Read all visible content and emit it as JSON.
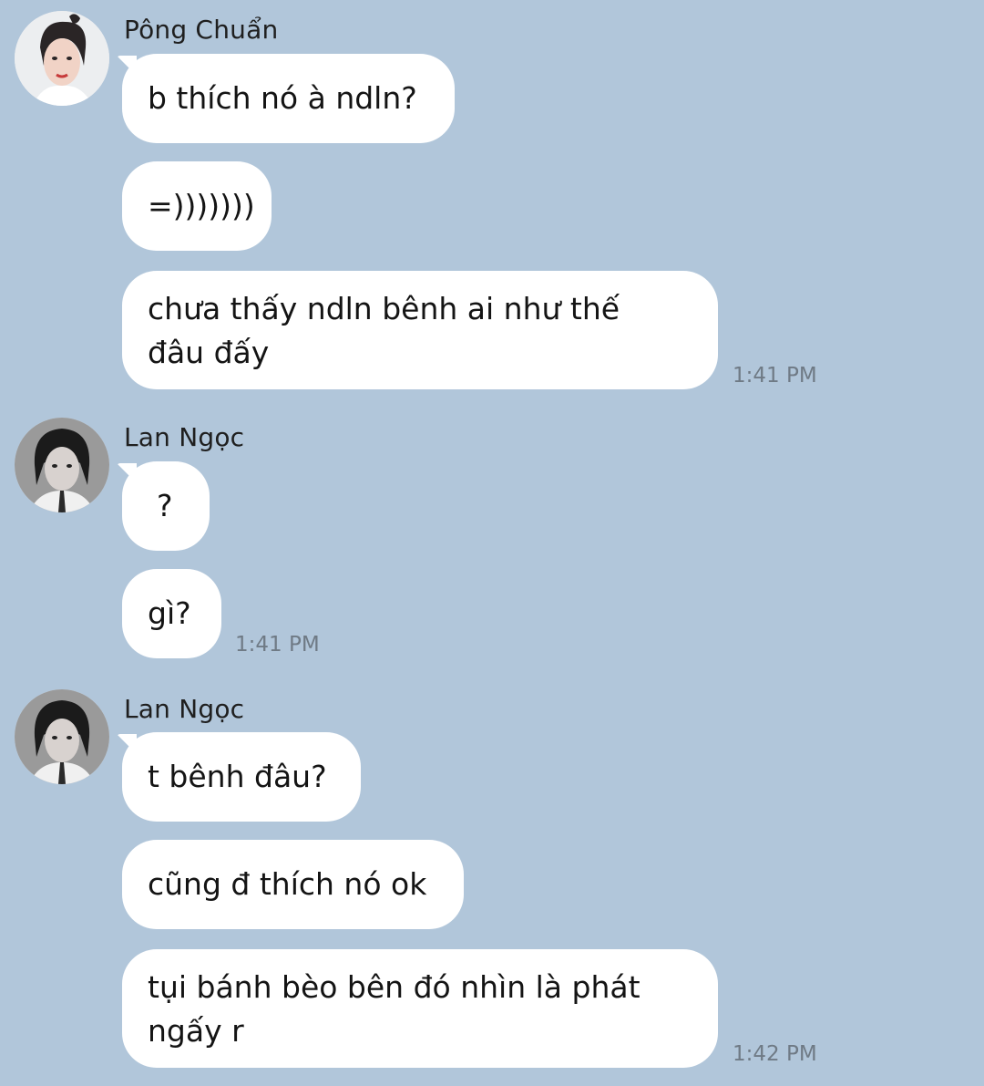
{
  "groups": [
    {
      "sender": "Pông Chuẩn",
      "avatar_icon": "contact-avatar-pong-chuan",
      "messages": [
        "b thích nó à ndln?",
        "=)))))))",
        "chưa thấy ndln bênh ai như thế\nđâu đấy"
      ],
      "time": "1:41 PM"
    },
    {
      "sender": "Lan Ngọc",
      "avatar_icon": "contact-avatar-lan-ngoc",
      "messages": [
        "?",
        "gì?"
      ],
      "time": "1:41 PM"
    },
    {
      "sender": "Lan Ngọc",
      "avatar_icon": "contact-avatar-lan-ngoc",
      "messages": [
        "t bênh đâu?",
        "cũng đ thích nó ok",
        "tụi bánh bèo bên đó nhìn là phát\nngấy r"
      ],
      "time": "1:42 PM"
    }
  ],
  "colors": {
    "background": "#b1c6da",
    "bubble": "#ffffff",
    "timestamp": "#6f7a85"
  }
}
